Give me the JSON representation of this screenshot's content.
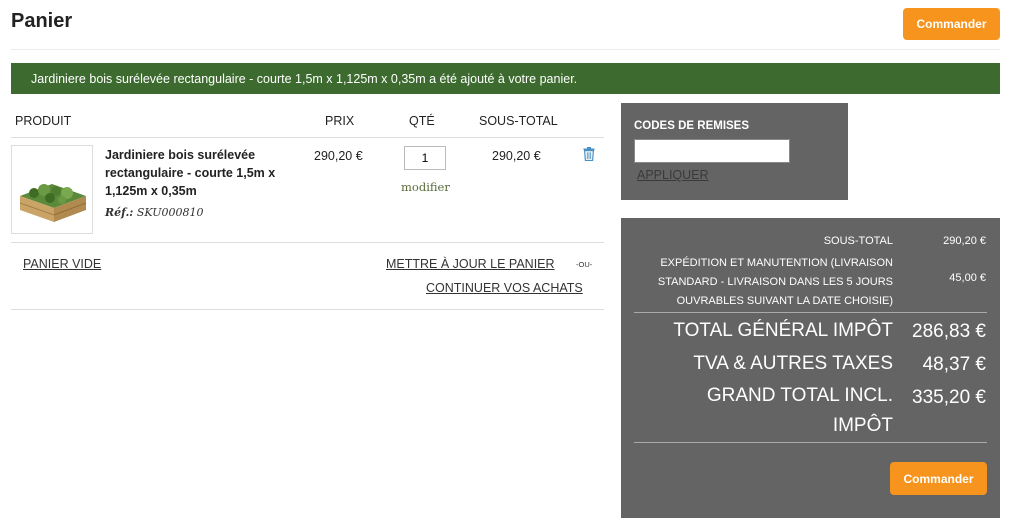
{
  "header": {
    "title": "Panier",
    "checkout_label": "Commander"
  },
  "banner": {
    "message": "Jardiniere bois surélevée rectangulaire - courte 1,5m x 1,125m x 0,35m a été ajouté à votre panier."
  },
  "cart": {
    "columns": [
      "PRODUIT",
      "PRIX",
      "QTÉ",
      "SOUS-TOTAL"
    ],
    "items": [
      {
        "image_icon": "raised-garden-bed-image",
        "name": "Jardiniere bois surélevée rectangulaire - courte 1,5m x 1,125m x 0,35m",
        "ref_label": "Réf.:",
        "ref_value": "SKU000810",
        "price": "290,20 €",
        "qty": "1",
        "modify_label": "modifier",
        "subtotal": "290,20 €",
        "delete_icon": "trash-icon"
      }
    ],
    "empty_cart_label": "PANIER VIDE",
    "update_cart_label": "METTRE À JOUR LE PANIER",
    "or_label": "-OU-",
    "continue_label": "CONTINUER VOS ACHATS"
  },
  "discount": {
    "title": "CODES DE REMISES",
    "input_value": "",
    "apply_label": "APPLIQUER"
  },
  "totals": {
    "subtotal_label": "SOUS-TOTAL",
    "subtotal_value": "290,20 €",
    "shipping_label": "EXPÉDITION ET MANUTENTION (LIVRAISON STANDARD - LIVRAISON DANS LES 5 JOURS OUVRABLES SUIVANT LA DATE CHOISIE)",
    "shipping_value": "45,00 €",
    "total_excl_label": "TOTAL GÉNÉRAL IMPÔT",
    "total_excl_value": "286,83 €",
    "tax_label": "TVA & AUTRES TAXES",
    "tax_value": "48,37 €",
    "total_incl_label": "GRAND TOTAL INCL. IMPÔT",
    "total_incl_value": "335,20 €",
    "checkout_label": "Commander"
  },
  "colors": {
    "accent": "#f7941d",
    "banner_green": "#3d6b2f",
    "panel_gray": "#646464",
    "trash_blue": "#4a90c2"
  }
}
